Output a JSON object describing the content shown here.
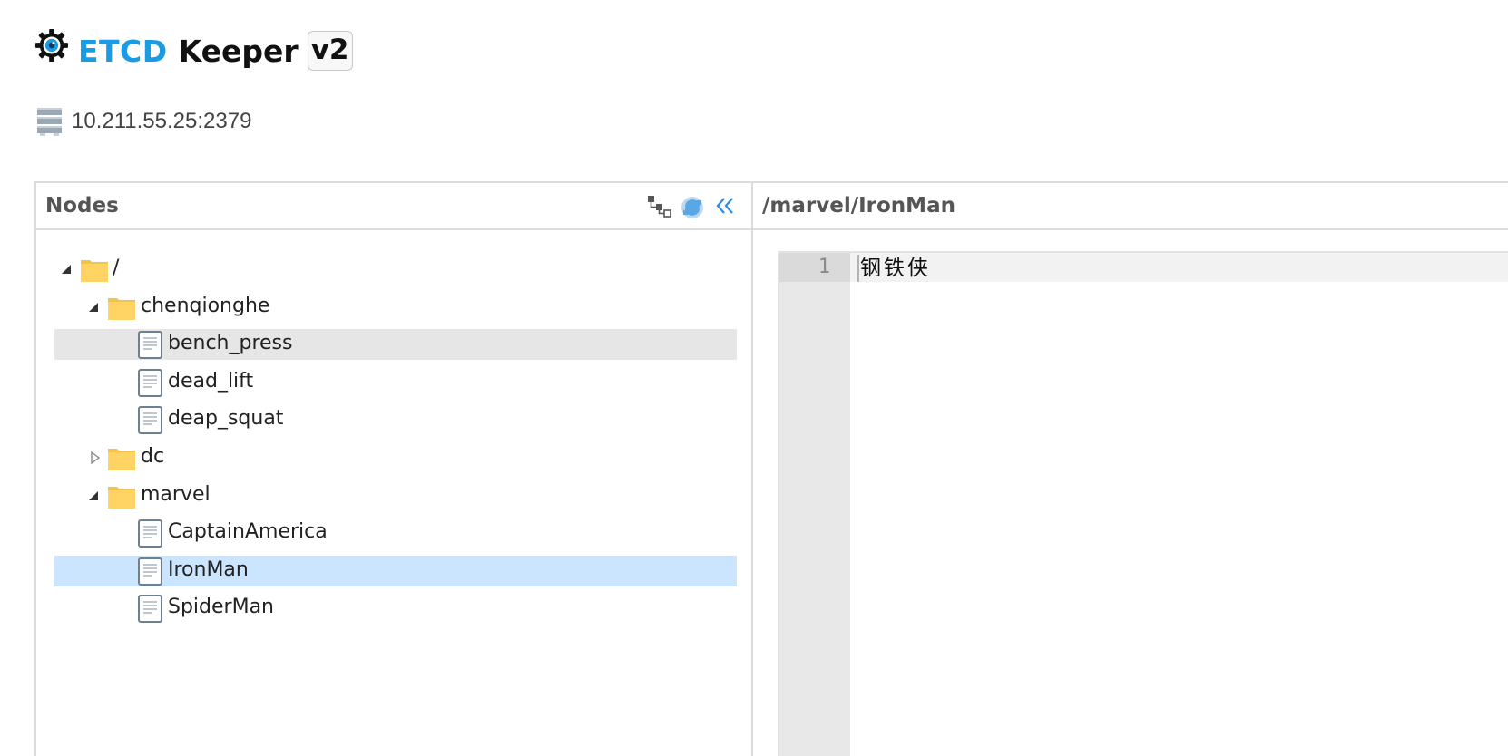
{
  "brand": {
    "name_part1": "ETCD",
    "name_part2": "Keeper",
    "version": "v2",
    "accent_color": "#1a9be6",
    "logo_icon": "gear-eye-icon"
  },
  "connection": {
    "host": "10.211.55.25:2379",
    "icon": "server-icon"
  },
  "nodes_panel": {
    "title": "Nodes",
    "tools": [
      {
        "name": "tree-view-icon"
      },
      {
        "name": "refresh-icon"
      },
      {
        "name": "collapse-panel-icon"
      }
    ],
    "tree": [
      {
        "label": "/",
        "type": "folder",
        "depth": 0,
        "state": "expanded"
      },
      {
        "label": "chenqionghe",
        "type": "folder",
        "depth": 1,
        "state": "expanded"
      },
      {
        "label": "bench_press",
        "type": "file",
        "depth": 2,
        "highlight": "hover"
      },
      {
        "label": "dead_lift",
        "type": "file",
        "depth": 2
      },
      {
        "label": "deap_squat",
        "type": "file",
        "depth": 2
      },
      {
        "label": "dc",
        "type": "folder",
        "depth": 1,
        "state": "collapsed"
      },
      {
        "label": "marvel",
        "type": "folder",
        "depth": 1,
        "state": "expanded"
      },
      {
        "label": "CaptainAmerica",
        "type": "file",
        "depth": 2
      },
      {
        "label": "IronMan",
        "type": "file",
        "depth": 2,
        "highlight": "selected"
      },
      {
        "label": "SpiderMan",
        "type": "file",
        "depth": 2
      }
    ]
  },
  "editor_panel": {
    "path": "/marvel/IronMan",
    "lines": [
      {
        "number": "1",
        "text": "钢铁侠"
      }
    ]
  }
}
